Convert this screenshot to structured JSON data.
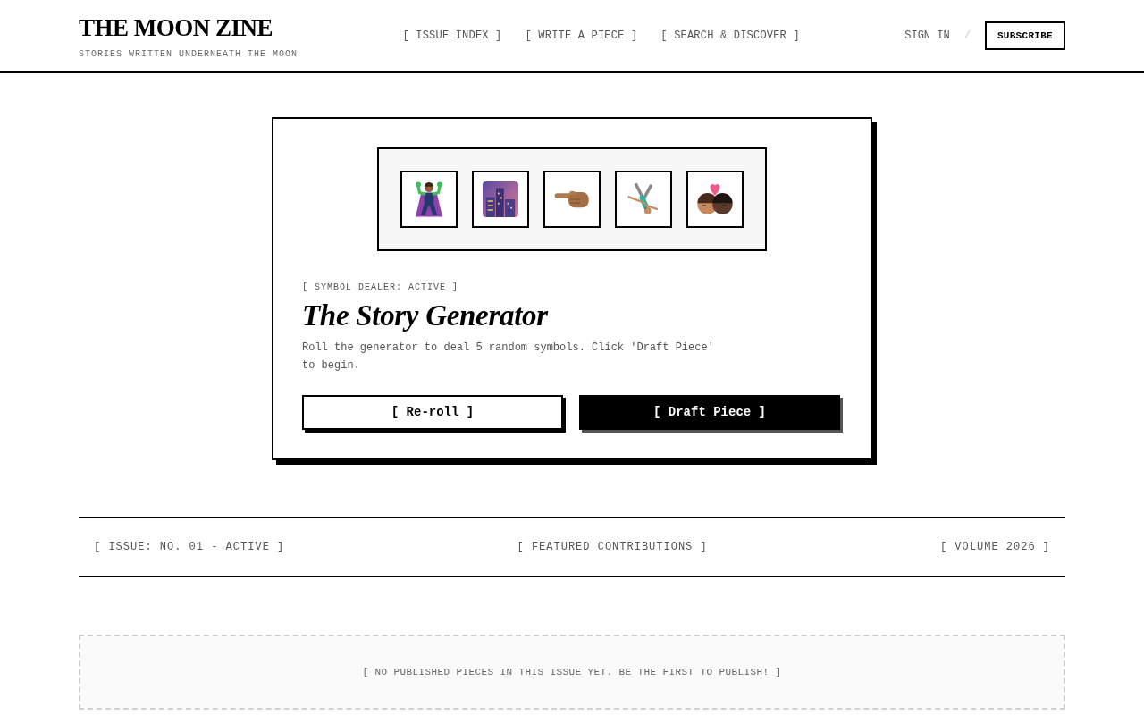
{
  "header": {
    "logo": "THE MOON ZINE",
    "tagline": "STORIES WRITTEN UNDERNEATH THE MOON",
    "nav": [
      "[ ISSUE INDEX ]",
      "[ WRITE A PIECE ]",
      "[ SEARCH & DISCOVER ]"
    ],
    "sign_in": "SIGN IN",
    "separator": "/",
    "subscribe": "SUBSCRIBE"
  },
  "generator": {
    "symbols": [
      {
        "kind": "villain"
      },
      {
        "kind": "city"
      },
      {
        "kind": "hand"
      },
      {
        "kind": "cartwheel"
      },
      {
        "kind": "kiss"
      }
    ],
    "status": "[ SYMBOL DEALER: ACTIVE ]",
    "title": "The Story Generator",
    "description": "Roll the generator to deal 5 random symbols. Click 'Draft Piece' to begin.",
    "buttons": [
      {
        "label": "[ Re-roll ]",
        "kind": "outline"
      },
      {
        "label": "[ Draft Piece ]",
        "kind": "solid"
      }
    ]
  },
  "section_bar": {
    "left": "[ ISSUE: NO. 01 - ACTIVE ]",
    "center": "[ FEATURED CONTRIBUTIONS ]",
    "right": "[ VOLUME 2026 ]"
  },
  "empty_state": "[ NO PUBLISHED PIECES IN THIS ISSUE YET. BE THE FIRST TO PUBLISH! ]"
}
